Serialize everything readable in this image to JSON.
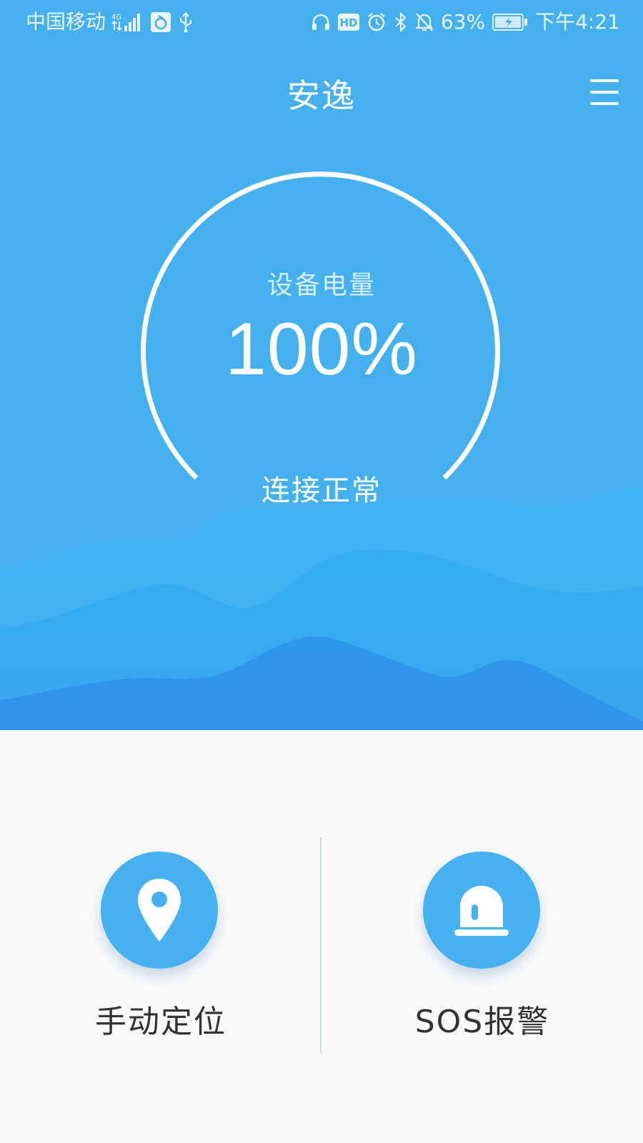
{
  "status_bar": {
    "carrier": "中国移动",
    "network": "4G",
    "battery_percent": "63%",
    "time": "下午4:21",
    "icons": [
      "signal-icon",
      "app-notification-icon",
      "usb-icon",
      "headset-icon",
      "hd-icon",
      "alarm-icon",
      "bluetooth-icon",
      "mute-icon",
      "battery-charging-icon"
    ]
  },
  "app_bar": {
    "title": "安逸",
    "menu_icon": "hamburger-menu-icon"
  },
  "gauge": {
    "label": "设备电量",
    "value": "100%",
    "status": "连接正常"
  },
  "actions": [
    {
      "label": "手动定位",
      "icon": "location-pin-icon"
    },
    {
      "label": "SOS报警",
      "icon": "alarm-siren-icon"
    }
  ],
  "colors": {
    "primary": "#45b0ee",
    "button": "#46b1ef",
    "mountain_dark": "#2b8fe8",
    "background": "#fafafa",
    "text_dark": "#333333"
  }
}
